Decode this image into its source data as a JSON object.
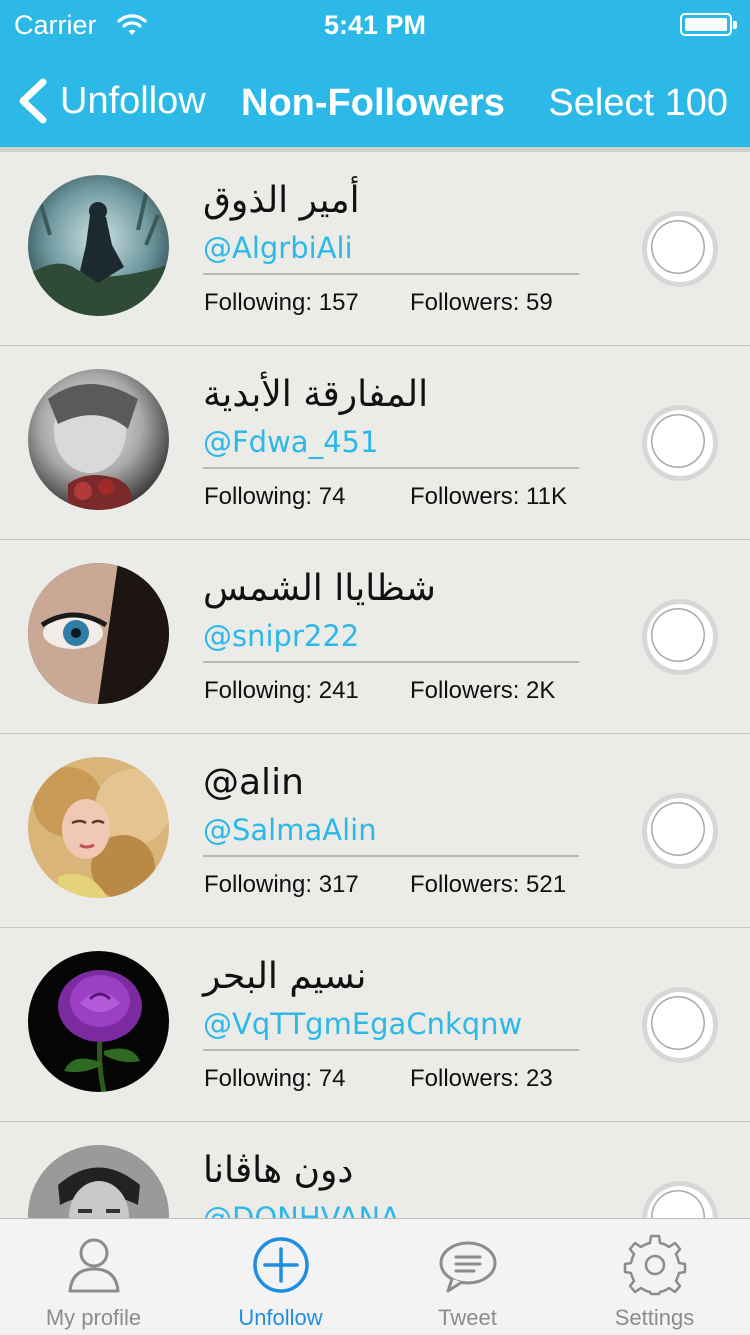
{
  "status_bar": {
    "carrier": "Carrier",
    "time": "5:41 PM"
  },
  "navbar": {
    "back_label": "Unfollow",
    "title": "Non-Followers",
    "select_label": "Select 100"
  },
  "list": [
    {
      "name": "أمير الذوق",
      "handle": "@AlgrbiAli",
      "following": "Following: 157",
      "followers": "Followers: 59",
      "avatar": "misty-forest-rider"
    },
    {
      "name": "المفارقة الأبدية",
      "handle": "@Fdwa_451",
      "following": "Following: 74",
      "followers": "Followers: 11K",
      "avatar": "grayscale-child-with-roses"
    },
    {
      "name": "شظاياا الشمس",
      "handle": "@snipr222",
      "following": "Following: 241",
      "followers": "Followers: 2K",
      "avatar": "veiled-blue-eye"
    },
    {
      "name": "@alin",
      "handle": "@SalmaAlin",
      "following": "Following: 317",
      "followers": "Followers: 521",
      "avatar": "golden-hair-woman"
    },
    {
      "name": "نسيم البحر",
      "handle": "@VqTTgmEgaCnkqnw",
      "following": "Following: 74",
      "followers": "Followers: 23",
      "avatar": "purple-rose"
    },
    {
      "name": "دون هاڤانا",
      "handle": "@DONHVANA",
      "following": "",
      "followers": "",
      "avatar": "man-portrait"
    }
  ],
  "tabbar": {
    "items": [
      {
        "label": "My profile",
        "icon": "person-icon"
      },
      {
        "label": "Unfollow",
        "icon": "plus-circle-icon",
        "active": true
      },
      {
        "label": "Tweet",
        "icon": "chat-bubble-icon"
      },
      {
        "label": "Settings",
        "icon": "gear-icon"
      }
    ]
  },
  "colors": {
    "accent": "#2db9e8",
    "tab_active": "#1f8ee0",
    "background": "#ebebe8"
  }
}
